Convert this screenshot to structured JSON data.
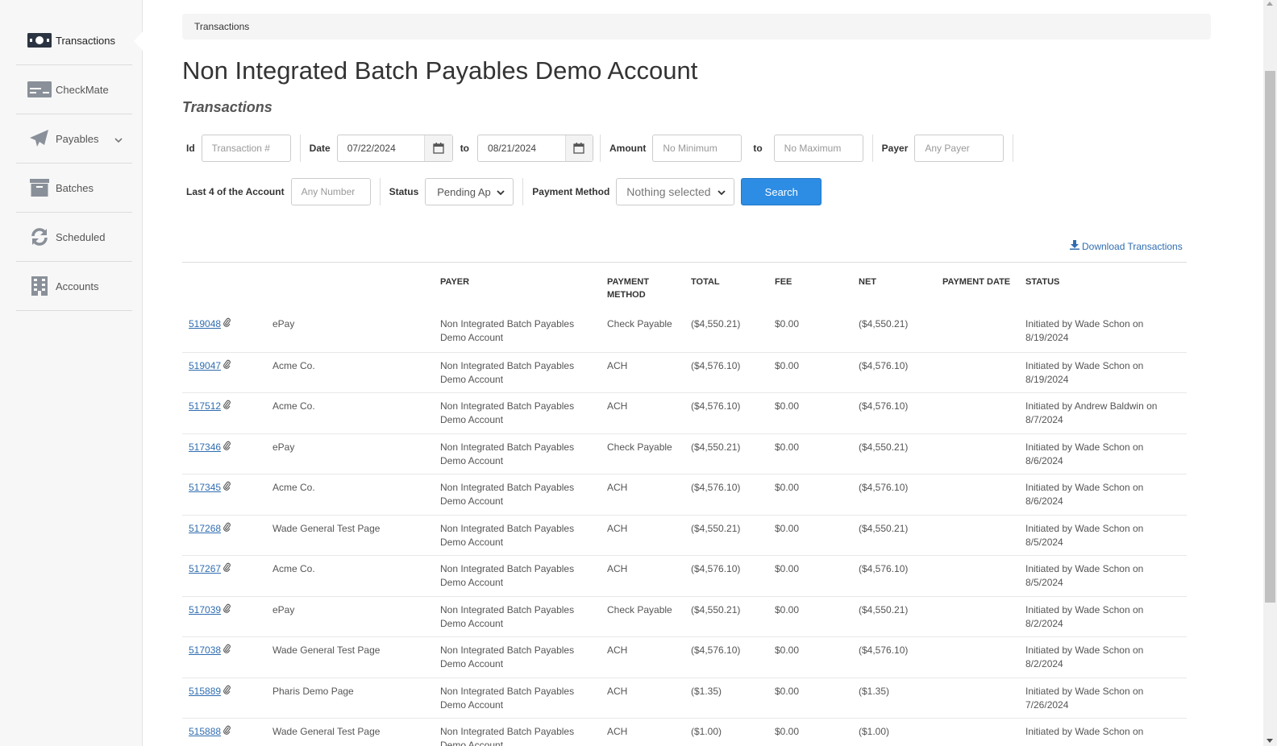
{
  "sidebar": {
    "items": [
      {
        "label": "Transactions",
        "icon": "money-icon",
        "active": true
      },
      {
        "label": "CheckMate",
        "icon": "check-card-icon"
      },
      {
        "label": "Payables",
        "icon": "paper-plane-icon",
        "has_dropdown": true
      },
      {
        "label": "Batches",
        "icon": "archive-box-icon"
      },
      {
        "label": "Scheduled",
        "icon": "refresh-icon"
      },
      {
        "label": "Accounts",
        "icon": "building-icon"
      }
    ]
  },
  "breadcrumb": "Transactions",
  "page_title": "Non Integrated Batch Payables Demo Account",
  "page_subtitle": "Transactions",
  "filters": {
    "id_label": "Id",
    "id_placeholder": "Transaction #",
    "date_label": "Date",
    "date_from": "07/22/2024",
    "to_label": "to",
    "date_to": "08/21/2024",
    "amount_label": "Amount",
    "amount_min_placeholder": "No Minimum",
    "amount_to_label": "to",
    "amount_max_placeholder": "No Maximum",
    "payer_label": "Payer",
    "payer_placeholder": "Any Payer",
    "last4_label": "Last 4 of the Account",
    "last4_placeholder": "Any Number",
    "status_label": "Status",
    "status_value": "Pending Ap",
    "payment_method_label": "Payment Method",
    "payment_method_value": "Nothing selected",
    "search_button": "Search"
  },
  "download_link": "Download Transactions",
  "table": {
    "headers": {
      "payer": "PAYER",
      "payment_method_1": "PAYMENT",
      "payment_method_2": "METHOD",
      "total": "TOTAL",
      "fee": "FEE",
      "net": "NET",
      "payment_date": "PAYMENT DATE",
      "status": "STATUS"
    },
    "rows": [
      {
        "id": "519048",
        "payee": "ePay",
        "payer": "Non Integrated Batch Payables Demo Account",
        "method": "Check Payable",
        "total": "($4,550.21)",
        "fee": "$0.00",
        "net": "($4,550.21)",
        "payment_date": "",
        "status": "Initiated by Wade Schon on 8/19/2024"
      },
      {
        "id": "519047",
        "payee": "Acme Co.",
        "payer": "Non Integrated Batch Payables Demo Account",
        "method": "ACH",
        "total": "($4,576.10)",
        "fee": "$0.00",
        "net": "($4,576.10)",
        "payment_date": "",
        "status": "Initiated by Wade Schon on 8/19/2024"
      },
      {
        "id": "517512",
        "payee": "Acme Co.",
        "payer": "Non Integrated Batch Payables Demo Account",
        "method": "ACH",
        "total": "($4,576.10)",
        "fee": "$0.00",
        "net": "($4,576.10)",
        "payment_date": "",
        "status": "Initiated by Andrew Baldwin on 8/7/2024"
      },
      {
        "id": "517346",
        "payee": "ePay",
        "payer": "Non Integrated Batch Payables Demo Account",
        "method": "Check Payable",
        "total": "($4,550.21)",
        "fee": "$0.00",
        "net": "($4,550.21)",
        "payment_date": "",
        "status": "Initiated by Wade Schon on 8/6/2024"
      },
      {
        "id": "517345",
        "payee": "Acme Co.",
        "payer": "Non Integrated Batch Payables Demo Account",
        "method": "ACH",
        "total": "($4,576.10)",
        "fee": "$0.00",
        "net": "($4,576.10)",
        "payment_date": "",
        "status": "Initiated by Wade Schon on 8/6/2024"
      },
      {
        "id": "517268",
        "payee": "Wade General Test Page",
        "payer": "Non Integrated Batch Payables Demo Account",
        "method": "ACH",
        "total": "($4,550.21)",
        "fee": "$0.00",
        "net": "($4,550.21)",
        "payment_date": "",
        "status": "Initiated by Wade Schon on 8/5/2024"
      },
      {
        "id": "517267",
        "payee": "Acme Co.",
        "payer": "Non Integrated Batch Payables Demo Account",
        "method": "ACH",
        "total": "($4,576.10)",
        "fee": "$0.00",
        "net": "($4,576.10)",
        "payment_date": "",
        "status": "Initiated by Wade Schon on 8/5/2024"
      },
      {
        "id": "517039",
        "payee": "ePay",
        "payer": "Non Integrated Batch Payables Demo Account",
        "method": "Check Payable",
        "total": "($4,550.21)",
        "fee": "$0.00",
        "net": "($4,550.21)",
        "payment_date": "",
        "status": "Initiated by Wade Schon on 8/2/2024"
      },
      {
        "id": "517038",
        "payee": "Wade General Test Page",
        "payer": "Non Integrated Batch Payables Demo Account",
        "method": "ACH",
        "total": "($4,576.10)",
        "fee": "$0.00",
        "net": "($4,576.10)",
        "payment_date": "",
        "status": "Initiated by Wade Schon on 8/2/2024"
      },
      {
        "id": "515889",
        "payee": "Pharis Demo Page",
        "payer": "Non Integrated Batch Payables Demo Account",
        "method": "ACH",
        "total": "($1.35)",
        "fee": "$0.00",
        "net": "($1.35)",
        "payment_date": "",
        "status": "Initiated by Wade Schon on 7/26/2024"
      },
      {
        "id": "515888",
        "payee": "Wade General Test Page",
        "payer": "Non Integrated Batch Payables Demo Account",
        "method": "ACH",
        "total": "($1.00)",
        "fee": "$0.00",
        "net": "($1.00)",
        "payment_date": "",
        "status": "Initiated by Wade Schon on"
      }
    ]
  },
  "colors": {
    "link": "#2f6db0",
    "primary_button": "#2d8ce3",
    "sidebar_bg": "#f7f7f7"
  }
}
